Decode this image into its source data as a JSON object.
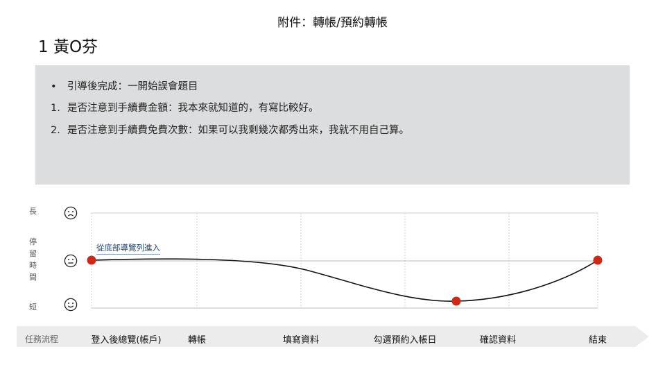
{
  "header": {
    "title": "附件：轉帳/預約轉帳"
  },
  "persona": {
    "name": "1 黃O芬"
  },
  "notes": {
    "bullet": "•",
    "items": [
      {
        "marker": "",
        "text": "引導後完成：一開始誤會題目"
      },
      {
        "marker": "1.",
        "text": "是否注意到手續費金額：我本來就知道的，有寫比較好。"
      },
      {
        "marker": "2.",
        "text": "是否注意到手續費免費次數：如果可以我剩幾次都秀出來，我就不用自己算。"
      }
    ]
  },
  "y_axis": {
    "top": "長",
    "middle": [
      "停",
      "留",
      "時",
      "間"
    ],
    "bottom": "短",
    "faces": [
      "sad-face-icon",
      "neutral-face-icon",
      "happy-face-icon"
    ]
  },
  "journey": {
    "start_annotation": "從底部導覽列進入",
    "line_color": "#111111",
    "point_color": "#cc2a18",
    "grid_color": "#c8c8c8",
    "points": [
      {
        "stage": 0,
        "level": "neutral"
      },
      {
        "stage": 3.5,
        "level": "short"
      },
      {
        "stage": 5,
        "level": "neutral"
      }
    ]
  },
  "stages": {
    "flow_label": "任務流程",
    "items": [
      "登入後總覽(帳戶)",
      "轉帳",
      "填寫資料",
      "勾選預約入帳日",
      "確認資料",
      "結束"
    ],
    "arrow_color": "#ececec"
  }
}
